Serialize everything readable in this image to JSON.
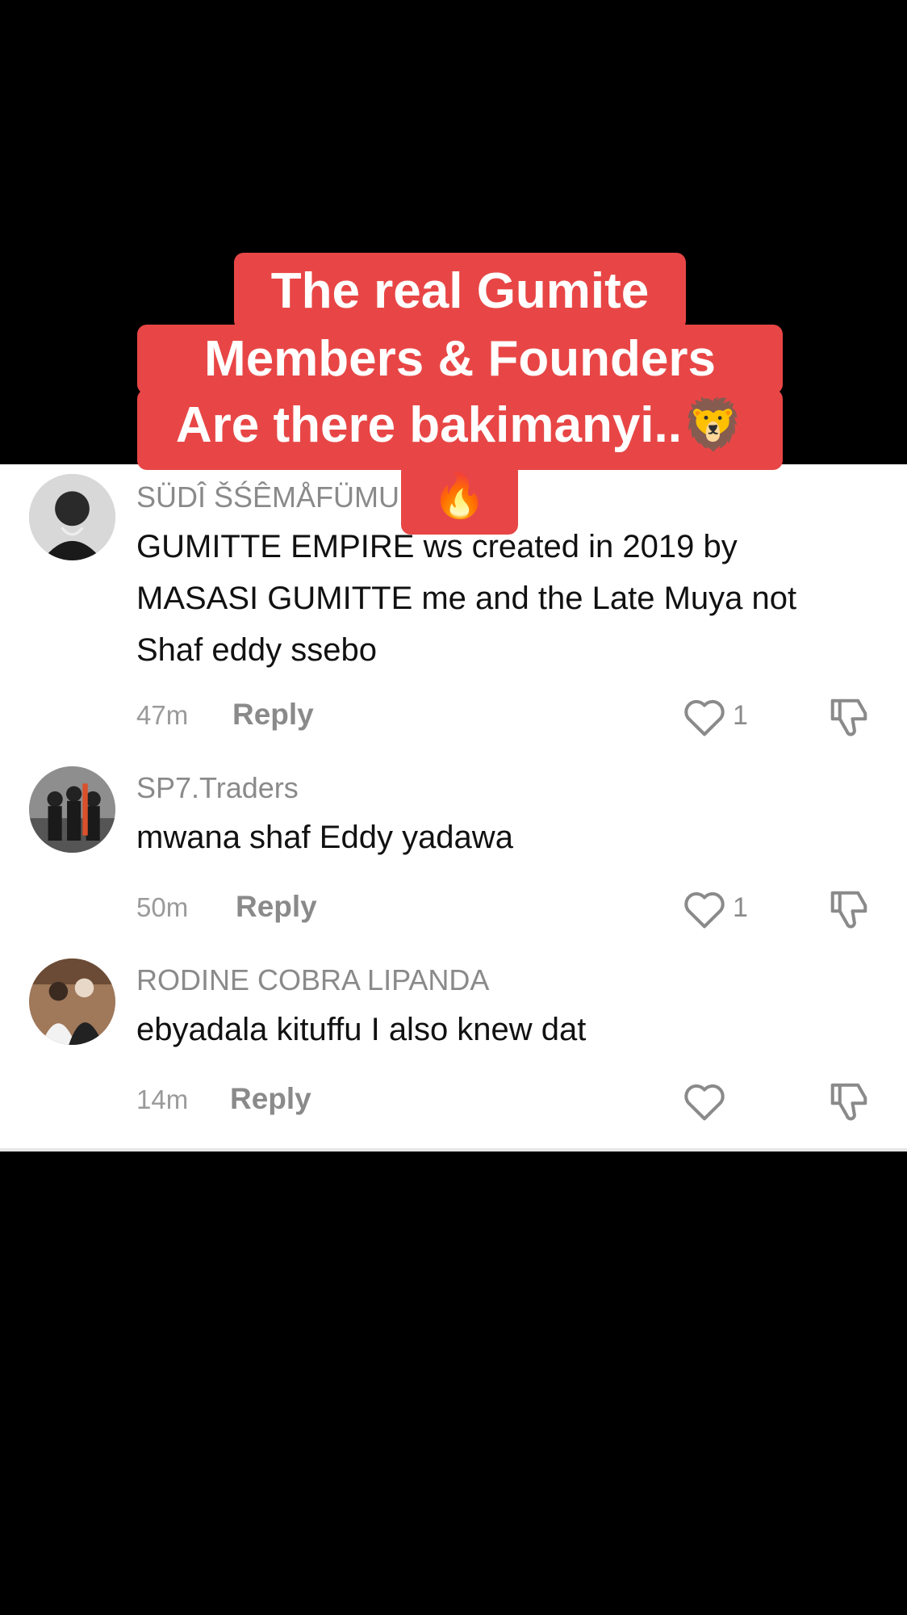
{
  "caption": {
    "line1": "The real Gumite",
    "line2": "Members & Founders",
    "line3": "Are there bakimanyi..🦁",
    "line4": "🔥"
  },
  "comments": [
    {
      "username": "SÜDÎ ŠŚÊMÅFÜMU",
      "text": "GUMITTE EMPIRE ws created in 2019 by MASASI GUMITTE me and the Late Muya not Shaf eddy ssebo",
      "time": "47m",
      "reply_label": "Reply",
      "likes": "1"
    },
    {
      "username": "SP7.Traders",
      "text": "mwana shaf Eddy yadawa",
      "time": "50m",
      "reply_label": "Reply",
      "likes": "1"
    },
    {
      "username": "RODINE COBRA LIPANDA",
      "text": "ebyadala kituffu I also knew dat",
      "time": "14m",
      "reply_label": "Reply",
      "likes": ""
    }
  ],
  "icons": {
    "like": "heart-outline-icon",
    "dislike": "thumbs-down-outline-icon"
  },
  "colors": {
    "caption_bg": "#e84646",
    "background": "#000000",
    "panel": "#ffffff"
  }
}
